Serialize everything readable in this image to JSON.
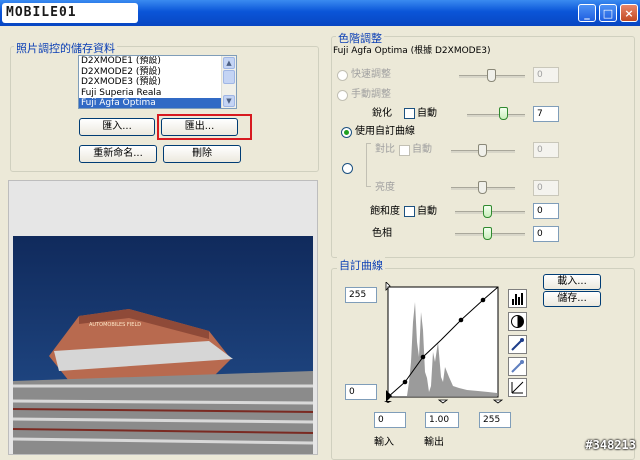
{
  "window": {
    "logo_text": "MOBILE01",
    "minimize": "_",
    "maximize": "□",
    "close": "×"
  },
  "presets": {
    "group_title": "照片調控的儲存資料",
    "items": [
      "D2XMODE1 (預設)",
      "D2XMODE2 (預設)",
      "D2XMODE3 (預設)",
      "Fuji Superia Reala",
      "Fuji Agfa Optima"
    ],
    "selected_index": 4,
    "import_label": "匯入...",
    "export_label": "匯出...",
    "rename_label": "重新命名...",
    "delete_label": "刪除"
  },
  "photo": {
    "stadium_sign": "AUTOMOBILES FIELD"
  },
  "tone": {
    "group_title": "色階調整",
    "subtitle": "Fuji Agfa Optima (根據 D2XMODE3)",
    "quick_label": "快速調整",
    "quick_value": "0",
    "manual_label": "手動調整",
    "sharpen_label": "銳化",
    "auto_label": "自動",
    "sharpen_value": "7",
    "custom_curve_label": "使用自訂曲線",
    "contrast_label": "對比",
    "contrast_value": "0",
    "brightness_label": "亮度",
    "brightness_value": "0",
    "saturation_label": "飽和度",
    "saturation_value": "0",
    "hue_label": "色相",
    "hue_value": "0"
  },
  "curve": {
    "group_title": "自訂曲線",
    "output_max": "255",
    "output_min": "0",
    "input_black": "0",
    "gamma": "1.00",
    "input_white": "255",
    "input_label": "輸入",
    "output_label": "輸出",
    "load_label": "載入...",
    "save_label": "儲存..."
  },
  "colors": {
    "accent_blue": "#0b3fb5",
    "highlight_red": "#d71920",
    "titlebar": "#0a55d8"
  },
  "watermark": "#348213"
}
